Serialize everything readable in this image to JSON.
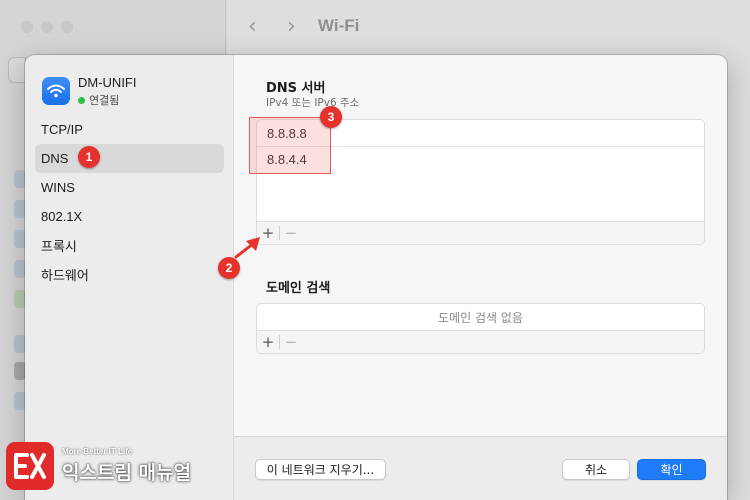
{
  "window": {
    "title": "Wi-Fi",
    "back_glyph": "‹",
    "forward_glyph": "›"
  },
  "network": {
    "name": "DM-UNIFI",
    "status": "연결됨",
    "icon": "wifi-icon"
  },
  "sidebar": {
    "items": [
      {
        "label": "TCP/IP"
      },
      {
        "label": "DNS",
        "selected": true
      },
      {
        "label": "WINS"
      },
      {
        "label": "802.1X"
      },
      {
        "label": "프록시"
      },
      {
        "label": "하드웨어"
      }
    ]
  },
  "dns": {
    "title": "DNS 서버",
    "subtitle": "IPv4 또는 IPv6 주소",
    "servers": [
      "8.8.8.8",
      "8.8.4.4"
    ],
    "add_label": "+",
    "remove_label": "−"
  },
  "domain": {
    "title": "도메인 검색",
    "empty_text": "도메인 검색 없음",
    "add_label": "+",
    "remove_label": "−"
  },
  "footer": {
    "forget_label": "이 네트워크 지우기...",
    "cancel_label": "취소",
    "ok_label": "확인"
  },
  "annotations": {
    "marker_1": "1",
    "marker_2": "2",
    "marker_3": "3",
    "color": "#e5322d"
  },
  "watermark": {
    "tagline": "More Better IT Life",
    "brand": "익스트림 매뉴얼"
  },
  "colors": {
    "accent": "#1f7bf6",
    "connected": "#2dbe4f"
  }
}
